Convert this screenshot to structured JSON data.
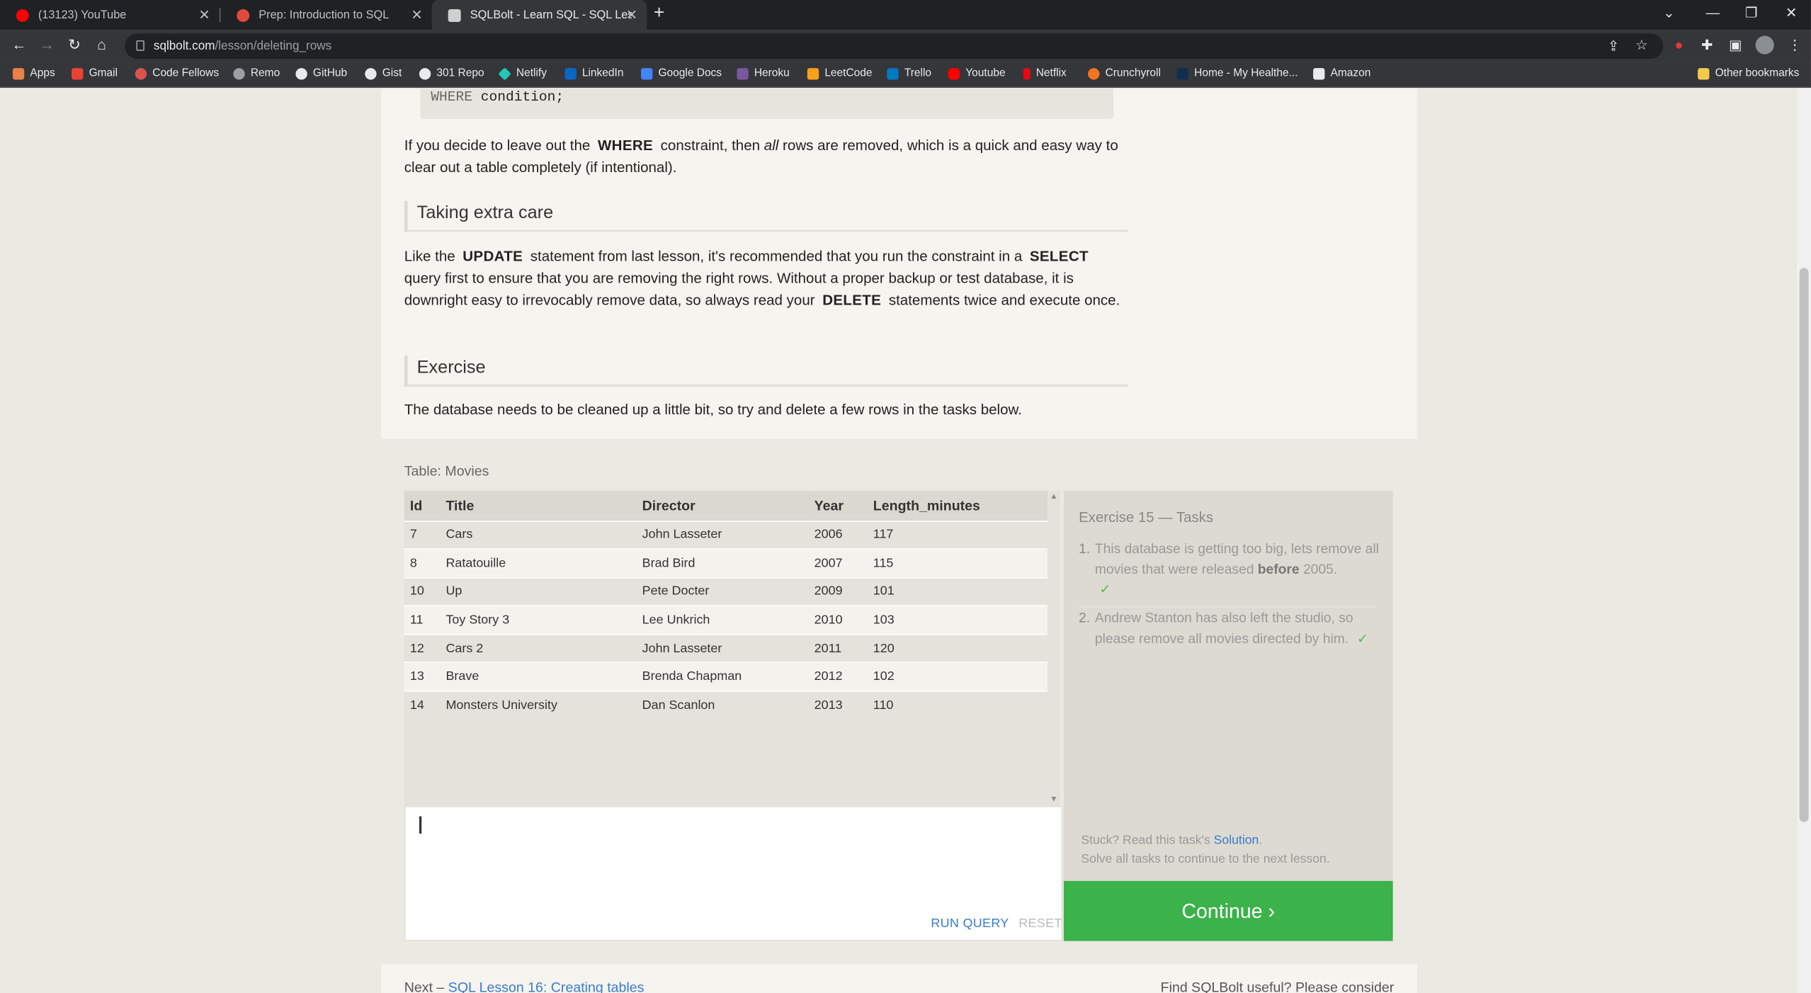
{
  "browser": {
    "tabs": [
      {
        "title": "(13123) YouTube",
        "color": "#ff0000"
      },
      {
        "title": "Prep: Introduction to SQL",
        "color": "#e04a3c"
      },
      {
        "title": "SQLBolt - Learn SQL - SQL Lesso",
        "color": "#cfcfcf"
      }
    ],
    "url_domain": "sqlbolt.com",
    "url_path": "/lesson/deleting_rows",
    "bookmarks": [
      {
        "label": "Apps",
        "color": "#e8804a"
      },
      {
        "label": "Gmail",
        "color": "#ea4335"
      },
      {
        "label": "Code Fellows",
        "color": "#d9534f"
      },
      {
        "label": "Remo",
        "color": "#9aa0a6"
      },
      {
        "label": "GitHub",
        "color": "#e8eaed"
      },
      {
        "label": "Gist",
        "color": "#e8eaed"
      },
      {
        "label": "301 Repo",
        "color": "#e8eaed"
      },
      {
        "label": "Netlify",
        "color": "#25c7b7"
      },
      {
        "label": "LinkedIn",
        "color": "#0a66c2"
      },
      {
        "label": "Google Docs",
        "color": "#4285f4"
      },
      {
        "label": "Heroku",
        "color": "#79589f"
      },
      {
        "label": "LeetCode",
        "color": "#f89f1b"
      },
      {
        "label": "Trello",
        "color": "#0079bf"
      },
      {
        "label": "Youtube",
        "color": "#ff0000"
      },
      {
        "label": "Netflix",
        "color": "#e50914"
      },
      {
        "label": "Crunchyroll",
        "color": "#f47521"
      },
      {
        "label": "Home - My Healthe...",
        "color": "#112e51"
      },
      {
        "label": "Amazon",
        "color": "#e8eaed"
      }
    ],
    "other_bookmarks": "Other bookmarks"
  },
  "lesson": {
    "code_tail_kw": "WHERE",
    "code_tail_rest": "condition;",
    "para1": {
      "a": "If you decide to leave out the",
      "kw": "WHERE",
      "b": "constraint, then",
      "em": "all",
      "c": "rows are removed, which is a quick and easy way to clear out a table completely (if intentional)."
    },
    "heading1": "Taking extra care",
    "para2": {
      "a": "Like the",
      "kw1": "UPDATE",
      "b": "statement from last lesson, it's recommended that you run the constraint in a",
      "kw2": "SELECT",
      "c": "query first to ensure that you are removing the right rows. Without a proper backup or test database, it is downright easy to irrevocably remove data, so always read your",
      "kw3": "DELETE",
      "d": "statements twice and execute once."
    },
    "heading2": "Exercise",
    "para3": "The database needs to be cleaned up a little bit, so try and delete a few rows in the tasks below."
  },
  "exercise": {
    "table_caption": "Table: Movies",
    "columns": [
      "Id",
      "Title",
      "Director",
      "Year",
      "Length_minutes"
    ],
    "rows": [
      [
        "7",
        "Cars",
        "John Lasseter",
        "2006",
        "117"
      ],
      [
        "8",
        "Ratatouille",
        "Brad Bird",
        "2007",
        "115"
      ],
      [
        "10",
        "Up",
        "Pete Docter",
        "2009",
        "101"
      ],
      [
        "11",
        "Toy Story 3",
        "Lee Unkrich",
        "2010",
        "103"
      ],
      [
        "12",
        "Cars 2",
        "John Lasseter",
        "2011",
        "120"
      ],
      [
        "13",
        "Brave",
        "Brenda Chapman",
        "2012",
        "102"
      ],
      [
        "14",
        "Monsters University",
        "Dan Scanlon",
        "2013",
        "110"
      ]
    ],
    "editor_value": "",
    "run_query": "RUN QUERY",
    "reset": "RESET",
    "tasks_title": "Exercise 15 — Tasks",
    "task1": {
      "num": "1.",
      "a": "This database is getting too big, lets remove all movies that were released",
      "bold": "before",
      "b": "2005.",
      "check": "✓"
    },
    "task2": {
      "num": "2.",
      "text": "Andrew Stanton has also left the studio, so please remove all movies directed by him.",
      "check": "✓"
    },
    "stuck_a": "Stuck? Read this task's",
    "stuck_link": "Solution",
    "stuck_b": ".",
    "stuck_line2": "Solve all tasks to continue to the next lesson.",
    "continue": "Continue ›",
    "next_prefix": "Next –",
    "next_link": "SQL Lesson 16: Creating tables",
    "support": "Find SQLBolt useful? Please consider"
  }
}
